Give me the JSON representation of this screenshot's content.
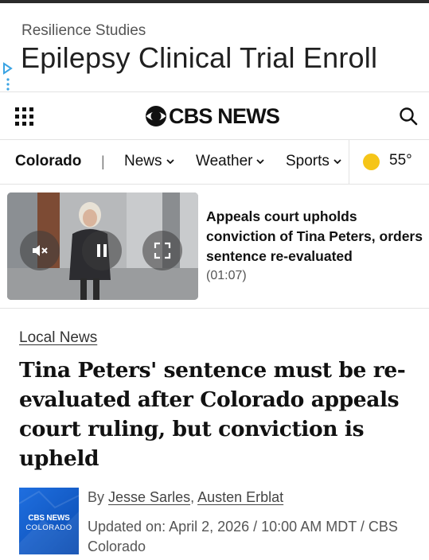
{
  "ad": {
    "sponsor": "Resilience Studies",
    "headline": "Epilepsy Clinical Trial Enroll",
    "choices_icon": "adchoices-icon"
  },
  "header": {
    "menu_icon": "grid-menu-icon",
    "logo_text": "CBS NEWS",
    "search_icon": "search-icon"
  },
  "nav": {
    "local": "Colorado",
    "separator": "|",
    "items": [
      {
        "label": "News"
      },
      {
        "label": "Weather"
      },
      {
        "label": "Sports"
      }
    ],
    "weather_icon": "sun-icon",
    "temperature": "55°",
    "sun_color": "#f5c518"
  },
  "promo": {
    "title": "Appeals court upholds conviction of Tina Peters, orders sentence re-evaluated",
    "duration": "(01:07)",
    "controls": [
      "mute-icon",
      "pause-icon",
      "fullscreen-icon"
    ]
  },
  "article": {
    "section": "Local News",
    "headline": "Tina Peters' sentence must be re-evaluated after Colorado appeals court ruling, but conviction is upheld",
    "avatar_line1": "CBS NEWS",
    "avatar_line2": "COLORADO",
    "byline_prefix": "By",
    "authors": [
      "Jesse Sarles",
      "Austen Erblat"
    ],
    "updated": "Updated on: April 2, 2026 / 10:00 AM MDT / CBS Colorado",
    "brand_color": "#1f6fe0"
  }
}
